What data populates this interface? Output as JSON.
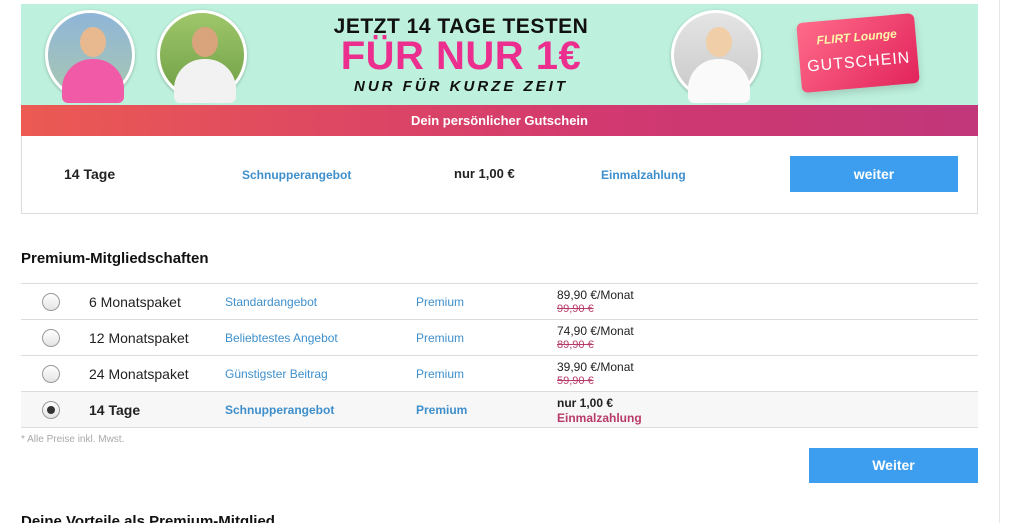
{
  "banner": {
    "headline": "JETZT 14 TAGE TESTEN",
    "price_line": "FÜR NUR 1€",
    "subline": "NUR FÜR KURZE ZEIT",
    "gift_brand": "FLIRT Lounge",
    "gift_label": "GUTSCHEIN",
    "background_color": "#bdf0dd",
    "accent_color": "#ec2e8f"
  },
  "voucher": {
    "title": "Dein persönlicher Gutschein",
    "duration": "14 Tage",
    "label": "Schnupperangebot",
    "price": "nur 1,00 €",
    "payment": "Einmalzahlung",
    "button": "weiter"
  },
  "premium": {
    "title": "Premium-Mitgliedschaften",
    "plans": [
      {
        "name": "6 Monatspaket",
        "description": "Standardangebot",
        "tier": "Premium",
        "price": "89,90 €/Monat",
        "old_price": "99,90 €",
        "selected": false
      },
      {
        "name": "12 Monatspaket",
        "description": "Beliebtestes Angebot",
        "tier": "Premium",
        "price": "74,90 €/Monat",
        "old_price": "89,90 €",
        "selected": false
      },
      {
        "name": "24 Monatspaket",
        "description": "Günstigster Beitrag",
        "tier": "Premium",
        "price": "39,90 €/Monat",
        "old_price": "59,90 €",
        "selected": false
      },
      {
        "name": "14 Tage",
        "description": "Schnupperangebot",
        "tier": "Premium",
        "price": "nur 1,00 €",
        "note": "Einmalzahlung",
        "selected": true
      }
    ],
    "footnote": "* Alle Preise inkl. Mwst.",
    "button": "Weiter"
  },
  "next_section": {
    "title": "Deine Vorteile als Premium-Mitglied"
  },
  "colors": {
    "button_blue": "#3d9eef",
    "link_blue": "#3e8fcc",
    "voucher_bar": "#d2396f",
    "old_price": "#b83a6a"
  }
}
